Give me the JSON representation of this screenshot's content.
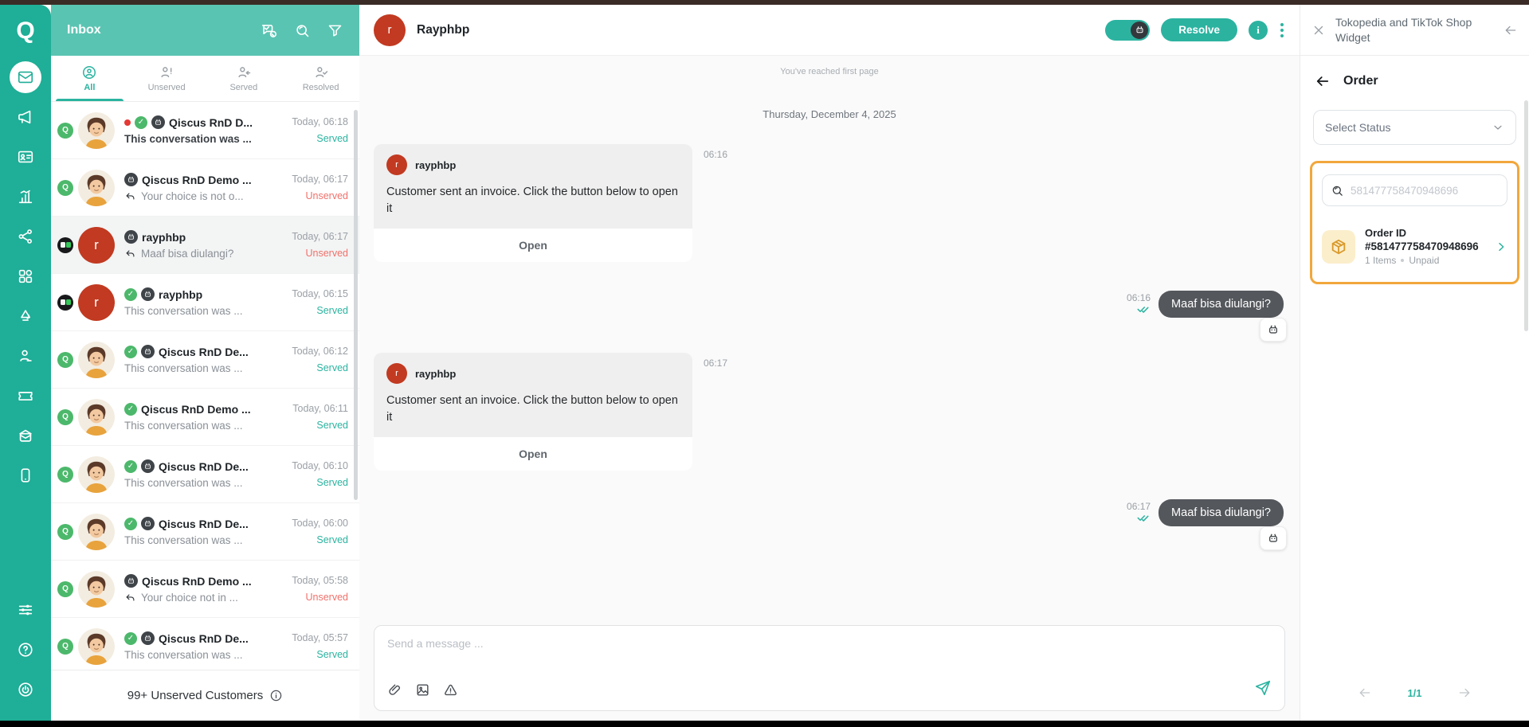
{
  "colors": {
    "accent": "#2bb3a0",
    "served": "#2bb3a0",
    "unserved": "#f0716b",
    "highlight_border": "#f2a73b",
    "rail": "#1fae97",
    "inbox_header": "#5ac4b2",
    "outgoing_bubble": "#54575c"
  },
  "sidebar": {
    "icons": [
      "qiscus-logo",
      "inbox",
      "broadcast",
      "contacts",
      "analytics",
      "integrations",
      "apps",
      "workflows",
      "agents",
      "ticketing",
      "mailbox",
      "mobile-apps",
      "settings",
      "help",
      "logout"
    ]
  },
  "inbox": {
    "title": "Inbox",
    "header_icons": [
      "chat-check-icon",
      "search-icon",
      "filter-icon"
    ],
    "tabs": [
      {
        "label": "All"
      },
      {
        "label": "Unserved"
      },
      {
        "label": "Served"
      },
      {
        "label": "Resolved"
      }
    ],
    "conversations": [
      {
        "badge": "qiscus",
        "avatar": "man",
        "avatar_letter": "",
        "unread": true,
        "resolved": true,
        "bot": true,
        "reply": false,
        "name": "Qiscus RnD D...",
        "preview": "This conversation was ...",
        "time": "Today, 06:18",
        "status": "Served",
        "selected": false
      },
      {
        "badge": "qiscus",
        "avatar": "man",
        "avatar_letter": "",
        "unread": false,
        "resolved": false,
        "bot": true,
        "reply": true,
        "name": "Qiscus RnD Demo ...",
        "preview": "Your choice is not o...",
        "time": "Today, 06:17",
        "status": "Unserved",
        "selected": false
      },
      {
        "badge": "shop",
        "avatar": "r",
        "avatar_letter": "r",
        "unread": false,
        "resolved": false,
        "bot": true,
        "reply": true,
        "name": "rayphbp",
        "preview": "Maaf bisa diulangi?",
        "time": "Today, 06:17",
        "status": "Unserved",
        "selected": true
      },
      {
        "badge": "shop",
        "avatar": "r",
        "avatar_letter": "r",
        "unread": false,
        "resolved": true,
        "bot": true,
        "reply": false,
        "name": "rayphbp",
        "preview": "This conversation was ...",
        "time": "Today, 06:15",
        "status": "Served",
        "selected": false
      },
      {
        "badge": "qiscus",
        "avatar": "man",
        "avatar_letter": "",
        "unread": false,
        "resolved": true,
        "bot": true,
        "reply": false,
        "name": "Qiscus RnD De...",
        "preview": "This conversation was ...",
        "time": "Today, 06:12",
        "status": "Served",
        "selected": false
      },
      {
        "badge": "qiscus",
        "avatar": "man",
        "avatar_letter": "",
        "unread": false,
        "resolved": true,
        "bot": false,
        "reply": false,
        "name": "Qiscus RnD Demo ...",
        "preview": "This conversation was ...",
        "time": "Today, 06:11",
        "status": "Served",
        "selected": false
      },
      {
        "badge": "qiscus",
        "avatar": "man",
        "avatar_letter": "",
        "unread": false,
        "resolved": true,
        "bot": true,
        "reply": false,
        "name": "Qiscus RnD De...",
        "preview": "This conversation was ...",
        "time": "Today, 06:10",
        "status": "Served",
        "selected": false
      },
      {
        "badge": "qiscus",
        "avatar": "man",
        "avatar_letter": "",
        "unread": false,
        "resolved": true,
        "bot": true,
        "reply": false,
        "name": "Qiscus RnD De...",
        "preview": "This conversation was ...",
        "time": "Today, 06:00",
        "status": "Served",
        "selected": false
      },
      {
        "badge": "qiscus",
        "avatar": "man",
        "avatar_letter": "",
        "unread": false,
        "resolved": false,
        "bot": true,
        "reply": true,
        "name": "Qiscus RnD Demo ...",
        "preview": "Your choice not in ...",
        "time": "Today, 05:58",
        "status": "Unserved",
        "selected": false
      },
      {
        "badge": "qiscus",
        "avatar": "man",
        "avatar_letter": "",
        "unread": false,
        "resolved": true,
        "bot": true,
        "reply": false,
        "name": "Qiscus RnD De...",
        "preview": "This conversation was ...",
        "time": "Today, 05:57",
        "status": "Served",
        "selected": false
      }
    ],
    "footer_label": "99+ Unserved Customers"
  },
  "chat": {
    "header": {
      "name": "Rayphbp",
      "avatar_letter": "r",
      "resolve_label": "Resolve",
      "info_label": "i"
    },
    "first_page_notice": "You've reached first page",
    "date_divider": "Thursday, December 4, 2025",
    "messages": [
      {
        "type": "incoming",
        "author": "rayphbp",
        "avatar_letter": "r",
        "text": "Customer sent an invoice. Click the button below to open it",
        "action": "Open",
        "time": "06:16"
      },
      {
        "type": "outgoing",
        "text": "Maaf bisa diulangi?",
        "time": "06:16"
      },
      {
        "type": "incoming",
        "author": "rayphbp",
        "avatar_letter": "r",
        "text": "Customer sent an invoice. Click the button below to open it",
        "action": "Open",
        "time": "06:17"
      },
      {
        "type": "outgoing",
        "text": "Maaf bisa diulangi?",
        "time": "06:17"
      }
    ],
    "composer": {
      "placeholder": "Send a message ..."
    }
  },
  "widget": {
    "title": "Tokopedia and TikTok Shop Widget",
    "section_title": "Order",
    "select_status_label": "Select Status",
    "search_value": "581477758470948696",
    "order": {
      "label": "Order ID",
      "number": "#581477758470948696",
      "items": "1 Items",
      "payment": "Unpaid"
    },
    "pagination": "1/1"
  }
}
